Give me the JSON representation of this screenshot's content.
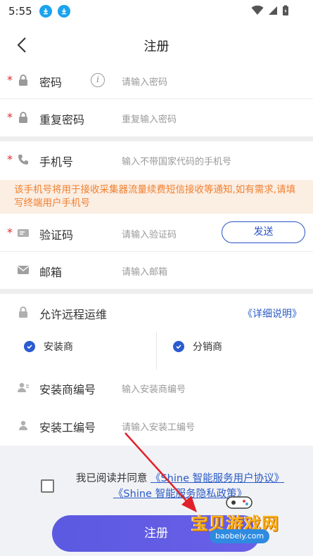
{
  "status": {
    "time": "5:55"
  },
  "nav": {
    "title": "注册"
  },
  "form": {
    "password": {
      "star": "*",
      "label": "密码",
      "info": "i",
      "placeholder": "请输入密码"
    },
    "repeat_password": {
      "star": "*",
      "label": "重复密码",
      "placeholder": "重复输入密码"
    },
    "phone": {
      "star": "*",
      "label": "手机号",
      "placeholder": "输入不带国家代码的手机号"
    },
    "notice": "该手机号将用于接收采集器流量续费短信接收等通知,如有需求,请填写终端用户手机号",
    "code": {
      "star": "*",
      "label": "验证码",
      "placeholder": "请输入验证码",
      "send": "发送"
    },
    "email": {
      "label": "邮箱",
      "placeholder": "请输入邮箱"
    },
    "remote": {
      "label": "允许远程运维",
      "detail": "《详细说明》"
    },
    "installer_check": {
      "label": "安装商",
      "checked": true
    },
    "distributor_check": {
      "label": "分销商",
      "checked": true
    },
    "installer_no": {
      "label": "安装商编号",
      "placeholder": "输入安装商编号"
    },
    "worker_no": {
      "label": "安装工编号",
      "placeholder": "请输入安装工编号"
    }
  },
  "agreement": {
    "prefix": "我已阅读并同意",
    "link1": "《Shine 智能服务用户协议》",
    "link2": "《Shine 智能服务隐私政策》"
  },
  "submit": {
    "label": "注册"
  },
  "watermark": {
    "text": "宝贝游戏网",
    "url": "baobeiy.com"
  },
  "colors": {
    "accent": "#2a5bc7",
    "button": "#5b5ae0",
    "required": "#e02b2b",
    "notice": "#f08030"
  }
}
